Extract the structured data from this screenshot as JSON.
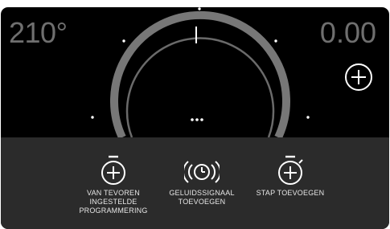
{
  "temperature": {
    "value": "210°"
  },
  "timer": {
    "value": "0.00"
  },
  "dial": {
    "ring_color": "#777777",
    "track_color": "#6a6a6a",
    "needle_color": "#ffffff",
    "tick_color": "#ffffff"
  },
  "controls": {
    "add_time_icon": "plus-circle-icon",
    "more_icon": "more-dots-icon"
  },
  "actions": [
    {
      "id": "preset",
      "icon": "timer-plus-icon",
      "label": "VAN TEVOREN\nINGESTELDE\nPROGRAMMERING"
    },
    {
      "id": "sound",
      "icon": "alarm-clock-sound-icon",
      "label": "GELUIDSSIGNAAL\nTOEVOEGEN"
    },
    {
      "id": "step",
      "icon": "timer-plus-icon",
      "label": "STAP TOEVOEGEN"
    }
  ],
  "colors": {
    "background": "#000000",
    "panel": "#2b2b2b",
    "text_dim": "#6f6f6f",
    "text_light": "#e6e6e6"
  }
}
